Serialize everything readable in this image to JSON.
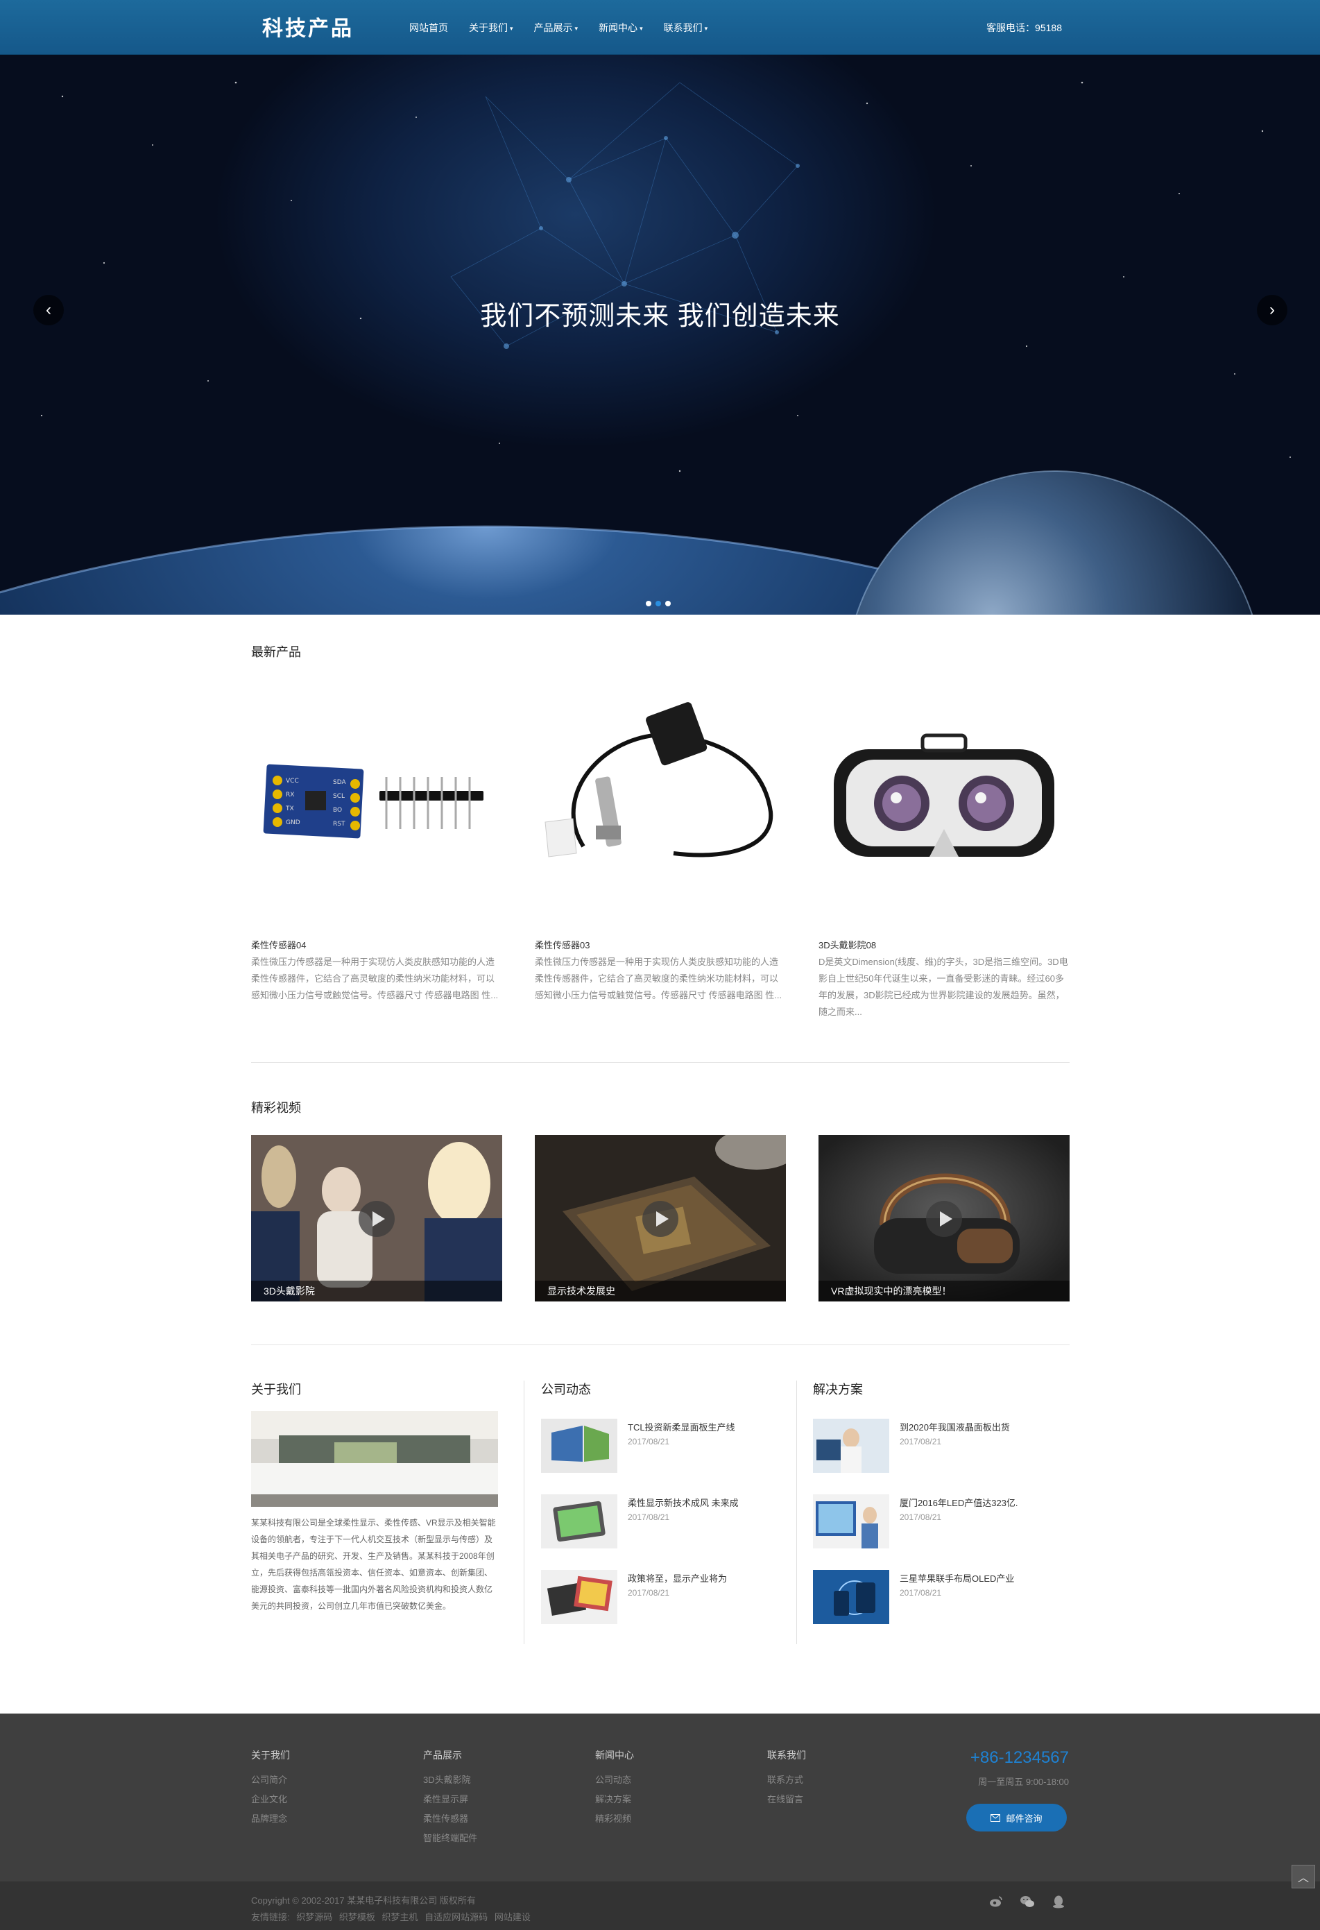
{
  "header": {
    "logo": "科技产品",
    "nav": [
      {
        "label": "网站首页",
        "caret": ""
      },
      {
        "label": "关于我们",
        "caret": "▾"
      },
      {
        "label": "产品展示",
        "caret": "▾"
      },
      {
        "label": "新闻中心",
        "caret": "▾"
      },
      {
        "label": "联系我们",
        "caret": "▾"
      }
    ],
    "phone": "客服电话：95188"
  },
  "banner": {
    "caption": "我们不预测未来  我们创造未来",
    "prev_icon": "chevron-left-icon",
    "next_icon": "chevron-right-icon",
    "slides": 3,
    "active_slide": 2
  },
  "products": {
    "title": "最新产品",
    "items": [
      {
        "name": "柔性传感器04",
        "desc": "柔性微压力传感器是一种用于实现仿人类皮肤感知功能的人造柔性传感器件，它结合了高灵敏度的柔性纳米功能材料，可以感知微小压力信号或触觉信号。传感器尺寸 传感器电路图 性..."
      },
      {
        "name": "柔性传感器03",
        "desc": "柔性微压力传感器是一种用于实现仿人类皮肤感知功能的人造柔性传感器件，它结合了高灵敏度的柔性纳米功能材料，可以感知微小压力信号或触觉信号。传感器尺寸 传感器电路图 性..."
      },
      {
        "name": "3D头戴影院08",
        "desc": "D是英文Dimension(线度、维)的字头，3D是指三维空间。3D电影自上世纪50年代诞生以来，一直备受影迷的青睐。经过60多年的发展，3D影院已经成为世界影院建设的发展趋势。虽然，随之而来..."
      }
    ]
  },
  "videos": {
    "title": "精彩视频",
    "items": [
      {
        "caption": "3D头戴影院"
      },
      {
        "caption": "显示技术发展史"
      },
      {
        "caption": "VR虚拟现实中的漂亮模型！"
      }
    ]
  },
  "about": {
    "title": "关于我们",
    "text": "某某科技有限公司是全球柔性显示、柔性传感、VR显示及相关智能设备的领航者，专注于下一代人机交互技术（新型显示与传感）及其相关电子产品的研究、开发、生产及销售。某某科技于2008年创立，先后获得包括高瓴投资本、信任资本、如意资本、创新集团、能源投资、富泰科技等一批国内外著名风险投资机构和投资人数亿美元的共同投资，公司创立几年市值已突破数亿美金。"
  },
  "news": {
    "title": "公司动态",
    "items": [
      {
        "title": "TCL投资新柔显面板生产线",
        "date": "2017/08/21"
      },
      {
        "title": "柔性显示新技术成风 未来成",
        "date": "2017/08/21"
      },
      {
        "title": "政策将至，显示产业将为",
        "date": "2017/08/21"
      }
    ]
  },
  "solutions": {
    "title": "解决方案",
    "items": [
      {
        "title": "到2020年我国液晶面板出货",
        "date": "2017/08/21"
      },
      {
        "title": "厦门2016年LED产值达323亿.",
        "date": "2017/08/21"
      },
      {
        "title": "三星苹果联手布局OLED产业",
        "date": "2017/08/21"
      }
    ]
  },
  "footer": {
    "columns": [
      {
        "head": "关于我们",
        "links": [
          "公司简介",
          "企业文化",
          "品牌理念"
        ]
      },
      {
        "head": "产品展示",
        "links": [
          "3D头戴影院",
          "柔性显示屏",
          "柔性传感器",
          "智能终端配件"
        ]
      },
      {
        "head": "新闻中心",
        "links": [
          "公司动态",
          "解决方案",
          "精彩视频"
        ]
      },
      {
        "head": "联系我们",
        "links": [
          "联系方式",
          "在线留言"
        ]
      }
    ],
    "phone": "+86-1234567",
    "hours": "周一至周五 9:00-18:00",
    "email_button": "邮件咨询",
    "email_icon": "mail-icon",
    "copyright": "Copyright © 2002-2017 某某电子科技有限公司 版权所有",
    "friend_links_label": "友情链接:",
    "friend_links": [
      "织梦源码",
      "织梦模板",
      "织梦主机",
      "自适应网站源码",
      "网站建设"
    ],
    "social_icons": [
      "weibo-icon",
      "wechat-icon",
      "qq-icon"
    ],
    "back_to_top_icon": "chevron-up-icon"
  },
  "colors": {
    "header_blue": "#1d6a9c",
    "accent_blue": "#1f82d2",
    "footer_bg": "#3f3f3f",
    "copyright_bg": "#333333"
  }
}
